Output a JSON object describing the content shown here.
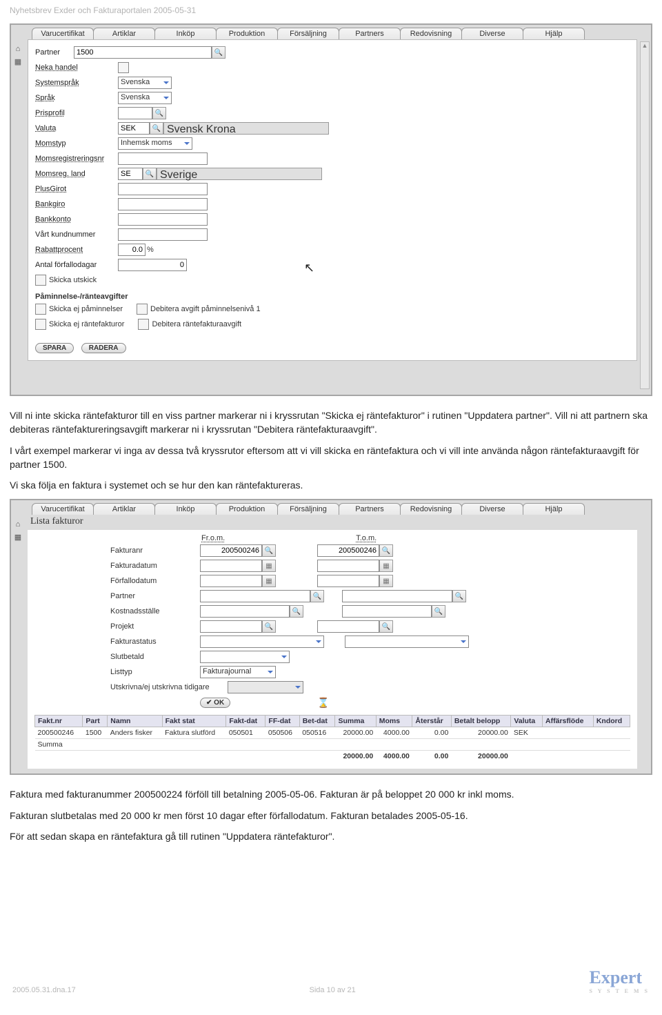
{
  "doc_header": "Nyhetsbrev Exder och Fakturaportalen 2005-05-31",
  "tabs": [
    "Varucertifikat",
    "Artiklar",
    "Inköp",
    "Produktion",
    "Försäljning",
    "Partners",
    "Redovisning",
    "Diverse",
    "Hjälp"
  ],
  "form1": {
    "partner_label": "Partner",
    "partner_value": "1500",
    "neka_handel": "Neka handel",
    "systemsprak": "Systemspråk",
    "systemsprak_val": "Svenska",
    "sprak": "Språk",
    "sprak_val": "Svenska",
    "prisprofil": "Prisprofil",
    "valuta": "Valuta",
    "valuta_code": "SEK",
    "valuta_name": "Svensk Krona",
    "momstyp": "Momstyp",
    "momstyp_val": "Inhemsk moms",
    "momsreg_nr": "Momsregistreringsnr",
    "momsreg_land": "Momsreg. land",
    "momsreg_land_code": "SE",
    "momsreg_land_name": "Sverige",
    "plusgirot": "PlusGirot",
    "bankgiro": "Bankgiro",
    "bankkonto": "Bankkonto",
    "vart_kundnr": "Vårt kundnummer",
    "rabattprocent": "Rabattprocent",
    "rabatt_val": "0.0",
    "rabatt_unit": "%",
    "antal_forfallo": "Antal förfallodagar",
    "antal_forfallo_val": "0",
    "skicka_utskick": "Skicka utskick",
    "section_title": "Påminnelse-/ränteavgifter",
    "chk1": "Skicka ej påminnelser",
    "chk2": "Debitera avgift påminnelsenivå 1",
    "chk3": "Skicka ej räntefakturor",
    "chk4": "Debitera räntefakturaavgift",
    "btn_save": "SPARA",
    "btn_delete": "RADERA"
  },
  "para1": "Vill ni inte skicka räntefakturor till en viss partner markerar ni i kryssrutan \"Skicka ej räntefakturor\" i rutinen \"Uppdatera partner\". Vill ni att partnern ska debiteras räntefaktureringsavgift markerar ni i kryssrutan \"Debitera räntefakturaavgift\".",
  "para2": "I vårt exempel markerar vi inga av dessa två kryssrutor eftersom att vi vill skicka en räntefaktura och vi vill inte använda någon räntefakturaavgift för partner 1500.",
  "para3": "Vi ska följa en faktura i systemet och se hur den kan räntefaktureras.",
  "page2_title": "Lista fakturor",
  "filters": {
    "from_label": "Fr.o.m.",
    "to_label": "T.o.m.",
    "fakturanr": "Fakturanr",
    "fakturanr_from": "200500246",
    "fakturanr_to": "200500246",
    "fakturadatum": "Fakturadatum",
    "forfallodatum": "Förfallodatum",
    "partner": "Partner",
    "kostnadsstalle": "Kostnadsställe",
    "projekt": "Projekt",
    "fakturastatus": "Fakturastatus",
    "slutbetald": "Slutbetald",
    "listtyp": "Listtyp",
    "listtyp_val": "Fakturajournal",
    "utskrivna": "Utskrivna/ej utskrivna tidigare",
    "btn_ok": "OK"
  },
  "table": {
    "headers": [
      "Fakt.nr",
      "Part",
      "Namn",
      "Fakt stat",
      "Fakt-dat",
      "FF-dat",
      "Bet-dat",
      "Summa",
      "Moms",
      "Återstår",
      "Betalt belopp",
      "Valuta",
      "Affärsflöde",
      "Kndord"
    ],
    "row": {
      "faktnr": "200500246",
      "part": "1500",
      "namn": "Anders fisker",
      "stat": "Faktura slutförd",
      "faktdat": "050501",
      "ffdat": "050506",
      "betdat": "050516",
      "summa": "20000.00",
      "moms": "4000.00",
      "aterstar": "0.00",
      "betalt": "20000.00",
      "valuta": "SEK",
      "flode": "",
      "kndord": ""
    },
    "sum_label": "Summa",
    "sum": {
      "summa": "20000.00",
      "moms": "4000.00",
      "aterstar": "0.00",
      "betalt": "20000.00"
    }
  },
  "para4": "Faktura med fakturanummer 200500224 förföll till betalning 2005-05-06. Fakturan är på beloppet 20 000 kr inkl moms.",
  "para5": "Fakturan slutbetalas med 20 000 kr men först 10 dagar efter förfallodatum. Fakturan betalades 2005-05-16.",
  "para6": "För att sedan skapa en räntefaktura gå till rutinen \"Uppdatera räntefakturor\".",
  "footer_left": "2005.05.31.dna.17",
  "footer_center": "Sida 10 av 21",
  "footer_logo": "Expert",
  "footer_logo_sub": "S Y S T E M S"
}
